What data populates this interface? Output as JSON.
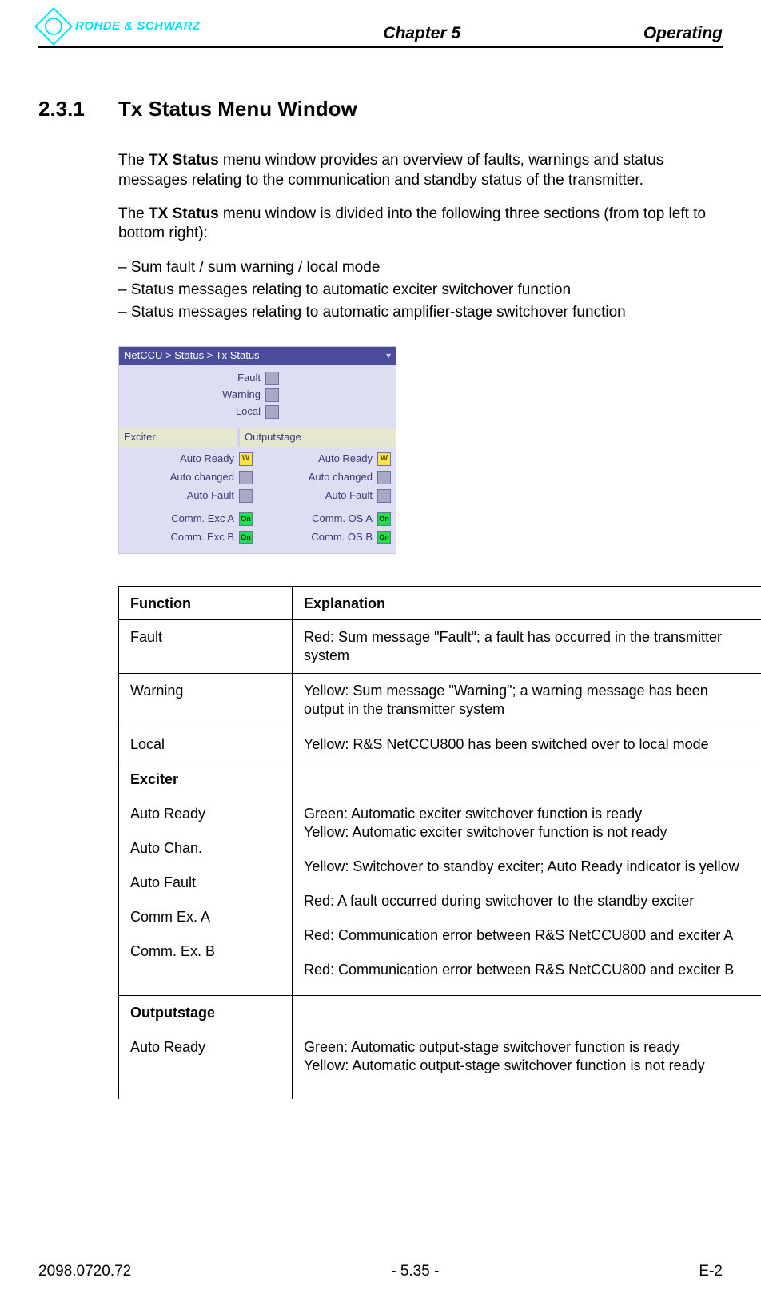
{
  "header": {
    "logo_text": "ROHDE & SCHWARZ",
    "chapter": "Chapter 5",
    "section_title": "Operating"
  },
  "section": {
    "number": "2.3.1",
    "title": "Tx Status Menu Window"
  },
  "paragraphs": {
    "p1a": "The ",
    "p1b": "TX Status",
    "p1c": " menu window provides an overview of faults, warnings and status messages relating to the communication and standby status of the transmitter.",
    "p2a": "The ",
    "p2b": "TX Status",
    "p2c": " menu window is divided into the following three sections (from top left to bottom right):"
  },
  "bullets": {
    "b1": "Sum fault / sum warning / local mode",
    "b2": "Status messages relating to automatic exciter switchover function",
    "b3": "Status messages relating to automatic amplifier-stage switchover function"
  },
  "screenshot": {
    "title": "NetCCU  >  Status >  Tx  Status",
    "top": {
      "fault": "Fault",
      "warning": "Warning",
      "local": "Local"
    },
    "band": {
      "left": "Exciter",
      "right": "Outputstage"
    },
    "exciter": {
      "auto_ready": "Auto Ready",
      "auto_changed": "Auto changed",
      "auto_fault": "Auto Fault",
      "comm_a": "Comm. Exc A",
      "comm_b": "Comm. Exc B"
    },
    "output": {
      "auto_ready": "Auto Ready",
      "auto_changed": "Auto changed",
      "auto_fault": "Auto Fault",
      "comm_a": "Comm. OS A",
      "comm_b": "Comm. OS B"
    },
    "badge_w": "W",
    "badge_on": "On"
  },
  "table": {
    "hdr_function": "Function",
    "hdr_explanation": "Explanation",
    "r_fault_f": "Fault",
    "r_fault_e": "Red: Sum message \"Fault\"; a fault has occurred in the transmitter system",
    "r_warn_f": "Warning",
    "r_warn_e": "Yellow: Sum message \"Warning\"; a warning message has been output in the transmitter system",
    "r_local_f": "Local",
    "r_local_e": "Yellow: R&S NetCCU800 has been switched over to local mode",
    "exc_head": "Exciter",
    "exc": {
      "f1": "Auto Ready",
      "e1a": "Green: Automatic exciter switchover function is ready",
      "e1b": "Yellow: Automatic exciter switchover function is not ready",
      "f2": "Auto Chan.",
      "e2": "Yellow: Switchover to standby exciter; Auto Ready indicator is yellow",
      "f3": "Auto Fault",
      "e3": "Red: A fault occurred during switchover to the standby exciter",
      "f4": "Comm Ex. A",
      "e4": "Red: Communication error between R&S NetCCU800 and exciter A",
      "f5": "Comm. Ex. B",
      "e5": "Red: Communication error between R&S NetCCU800 and exciter B"
    },
    "out_head": "Outputstage",
    "out": {
      "f1": "Auto Ready",
      "e1a": "Green: Automatic output-stage switchover function is ready",
      "e1b": "Yellow: Automatic output-stage switchover function is not ready"
    }
  },
  "footer": {
    "left": "2098.0720.72",
    "center": "- 5.35 -",
    "right": "E-2"
  }
}
